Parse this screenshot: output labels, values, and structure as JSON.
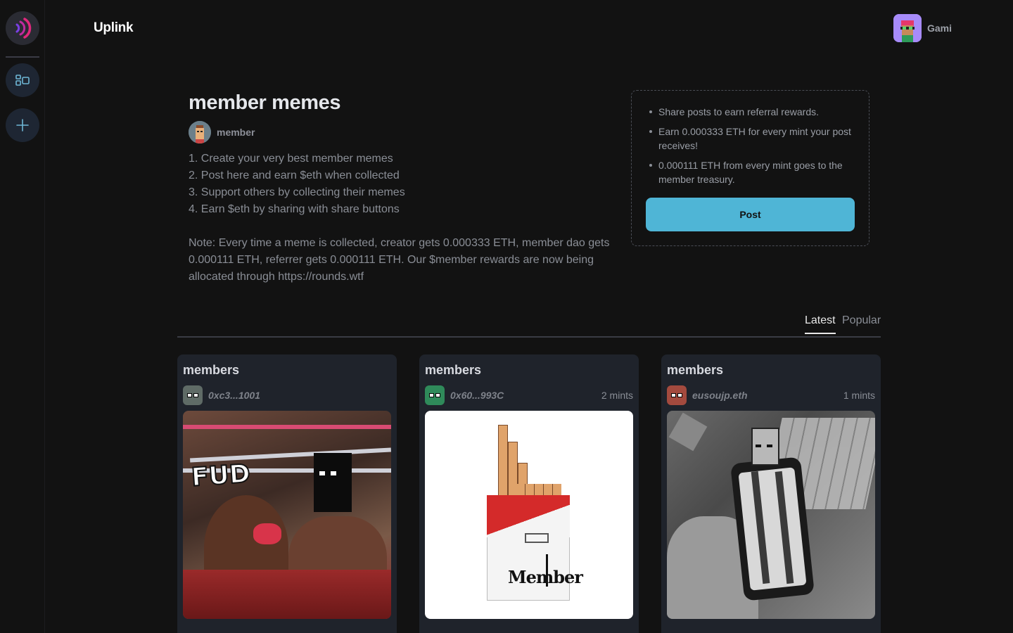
{
  "app": {
    "brand": "Uplink"
  },
  "user": {
    "name": "Gami"
  },
  "contest": {
    "title": "member memes",
    "author": "member",
    "rules": [
      "1. Create your very best member memes",
      "2. Post here and earn $eth when collected",
      "3. Support others by collecting their memes",
      "4. Earn $eth by sharing with share buttons"
    ],
    "note": "Note: Every time a meme is collected, creator gets 0.000333 ETH, member dao gets 0.000111 ETH, referrer gets 0.000111 ETH. Our $member rewards are now being allocated through https://rounds.wtf"
  },
  "rewards": {
    "items": [
      "Share posts to earn referral rewards.",
      "Earn 0.000333 ETH for every mint your post receives!",
      "0.000111 ETH from every mint goes to the member treasury."
    ],
    "post_label": "Post"
  },
  "tabs": {
    "latest": "Latest",
    "popular": "Popular"
  },
  "cards": [
    {
      "title": "members",
      "author": "0xc3...1001",
      "mints": "",
      "avatar_color": "#5f6b66",
      "media_text": "FUD"
    },
    {
      "title": "members",
      "author": "0x60...993C",
      "mints": "2 mints",
      "avatar_color": "#2f8a5a",
      "media_text": "Member"
    },
    {
      "title": "members",
      "author": "eusoujp.eth",
      "mints": "1 mints",
      "avatar_color": "#a34a3e",
      "media_text": ""
    }
  ],
  "colors": {
    "accent": "#4fb5d6",
    "background": "#121212",
    "card": "#1f232b",
    "logo_pink": "#e0287d",
    "logo_purple": "#7b3fe4"
  },
  "icons": {
    "logo": "uplink-logo-icon",
    "gallery": "gallery-icon",
    "add": "plus-icon"
  }
}
